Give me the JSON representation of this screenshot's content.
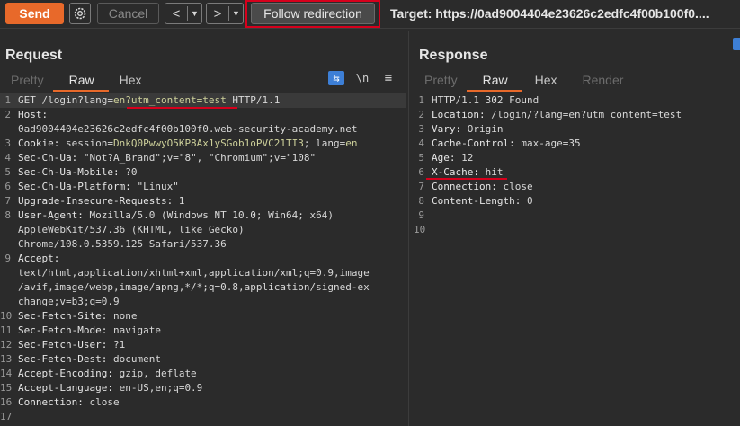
{
  "toolbar": {
    "send_label": "Send",
    "settings_icon": "gear-icon",
    "cancel_label": "Cancel",
    "back_arrow": "<",
    "forward_arrow": ">",
    "dropdown_glyph": "▼",
    "follow_label": "Follow redirection",
    "target_text": "Target: https://0ad9004404e23626c2edfc4f00b100f0...."
  },
  "request": {
    "title": "Request",
    "tabs": [
      "Pretty",
      "Raw",
      "Hex"
    ],
    "active_tab": "Raw",
    "icons": {
      "wrap": "⇆",
      "newline": "\\n",
      "menu": "≡"
    },
    "lines": [
      {
        "n": "1",
        "parts": [
          {
            "t": "GET /login?lang="
          },
          {
            "t": "en?utm_content=test",
            "c": "g"
          },
          {
            "t": " HTTP/1.1"
          }
        ]
      },
      {
        "n": "2",
        "parts": [
          {
            "t": "Host:",
            "c": "k"
          }
        ]
      },
      {
        "n": "",
        "parts": [
          {
            "t": "0ad9004404e23626c2edfc4f00b100f0.web-security-academy.net"
          }
        ]
      },
      {
        "n": "3",
        "parts": [
          {
            "t": "Cookie:",
            "c": "k"
          },
          {
            "t": " session="
          },
          {
            "t": "DnkQ0PwwyO5KP8Ax1ySGob1oPVC21TI3",
            "c": "g"
          },
          {
            "t": "; lang="
          },
          {
            "t": "en",
            "c": "g"
          }
        ]
      },
      {
        "n": "4",
        "parts": [
          {
            "t": "Sec-Ch-Ua:",
            "c": "k"
          },
          {
            "t": " \"Not?A_Brand\";v=\"8\", \"Chromium\";v=\"108\""
          }
        ]
      },
      {
        "n": "5",
        "parts": [
          {
            "t": "Sec-Ch-Ua-Mobile:",
            "c": "k"
          },
          {
            "t": " ?0"
          }
        ]
      },
      {
        "n": "6",
        "parts": [
          {
            "t": "Sec-Ch-Ua-Platform:",
            "c": "k"
          },
          {
            "t": " \"Linux\""
          }
        ]
      },
      {
        "n": "7",
        "parts": [
          {
            "t": "Upgrade-Insecure-Requests:",
            "c": "k"
          },
          {
            "t": " 1"
          }
        ]
      },
      {
        "n": "8",
        "parts": [
          {
            "t": "User-Agent:",
            "c": "k"
          },
          {
            "t": " Mozilla/5.0 (Windows NT 10.0; Win64; x64)"
          }
        ]
      },
      {
        "n": "",
        "parts": [
          {
            "t": "AppleWebKit/537.36 (KHTML, like Gecko)"
          }
        ]
      },
      {
        "n": "",
        "parts": [
          {
            "t": "Chrome/108.0.5359.125 Safari/537.36"
          }
        ]
      },
      {
        "n": "9",
        "parts": [
          {
            "t": "Accept:",
            "c": "k"
          }
        ]
      },
      {
        "n": "",
        "parts": [
          {
            "t": "text/html,application/xhtml+xml,application/xml;q=0.9,image"
          }
        ]
      },
      {
        "n": "",
        "parts": [
          {
            "t": "/avif,image/webp,image/apng,*/*;q=0.8,application/signed-ex"
          }
        ]
      },
      {
        "n": "",
        "parts": [
          {
            "t": "change;v=b3;q=0.9"
          }
        ]
      },
      {
        "n": "10",
        "parts": [
          {
            "t": "Sec-Fetch-Site:",
            "c": "k"
          },
          {
            "t": " none"
          }
        ]
      },
      {
        "n": "11",
        "parts": [
          {
            "t": "Sec-Fetch-Mode:",
            "c": "k"
          },
          {
            "t": " navigate"
          }
        ]
      },
      {
        "n": "12",
        "parts": [
          {
            "t": "Sec-Fetch-User:",
            "c": "k"
          },
          {
            "t": " ?1"
          }
        ]
      },
      {
        "n": "13",
        "parts": [
          {
            "t": "Sec-Fetch-Dest:",
            "c": "k"
          },
          {
            "t": " document"
          }
        ]
      },
      {
        "n": "14",
        "parts": [
          {
            "t": "Accept-Encoding:",
            "c": "k"
          },
          {
            "t": " gzip, deflate"
          }
        ]
      },
      {
        "n": "15",
        "parts": [
          {
            "t": "Accept-Language:",
            "c": "k"
          },
          {
            "t": " en-US,en;q=0.9"
          }
        ]
      },
      {
        "n": "16",
        "parts": [
          {
            "t": "Connection:",
            "c": "k"
          },
          {
            "t": " close"
          }
        ]
      },
      {
        "n": "17",
        "parts": [
          {
            "t": ""
          }
        ]
      }
    ]
  },
  "response": {
    "title": "Response",
    "tabs": [
      "Pretty",
      "Raw",
      "Hex",
      "Render"
    ],
    "active_tab": "Raw",
    "lines": [
      {
        "n": "1",
        "parts": [
          {
            "t": "HTTP/1.1 302 Found"
          }
        ]
      },
      {
        "n": "2",
        "parts": [
          {
            "t": "Location:",
            "c": "k"
          },
          {
            "t": " /login/?lang=en?utm_content=test"
          }
        ]
      },
      {
        "n": "3",
        "parts": [
          {
            "t": "Vary:",
            "c": "k"
          },
          {
            "t": " Origin"
          }
        ]
      },
      {
        "n": "4",
        "parts": [
          {
            "t": "Cache-Control:",
            "c": "k"
          },
          {
            "t": " max-age=35"
          }
        ]
      },
      {
        "n": "5",
        "parts": [
          {
            "t": "Age:",
            "c": "k"
          },
          {
            "t": " 12"
          }
        ]
      },
      {
        "n": "6",
        "parts": [
          {
            "t": "X-Cache:",
            "c": "k"
          },
          {
            "t": " hit"
          }
        ]
      },
      {
        "n": "7",
        "parts": [
          {
            "t": "Connection:",
            "c": "k"
          },
          {
            "t": " close"
          }
        ]
      },
      {
        "n": "8",
        "parts": [
          {
            "t": "Content-Length:",
            "c": "k"
          },
          {
            "t": " 0"
          }
        ]
      },
      {
        "n": "9",
        "parts": [
          {
            "t": ""
          }
        ]
      },
      {
        "n": "10",
        "parts": [
          {
            "t": ""
          }
        ]
      }
    ]
  },
  "colors": {
    "accent": "#e8692a",
    "annotation_red": "#d6001c",
    "wrap_blue": "#3d7fd6"
  }
}
